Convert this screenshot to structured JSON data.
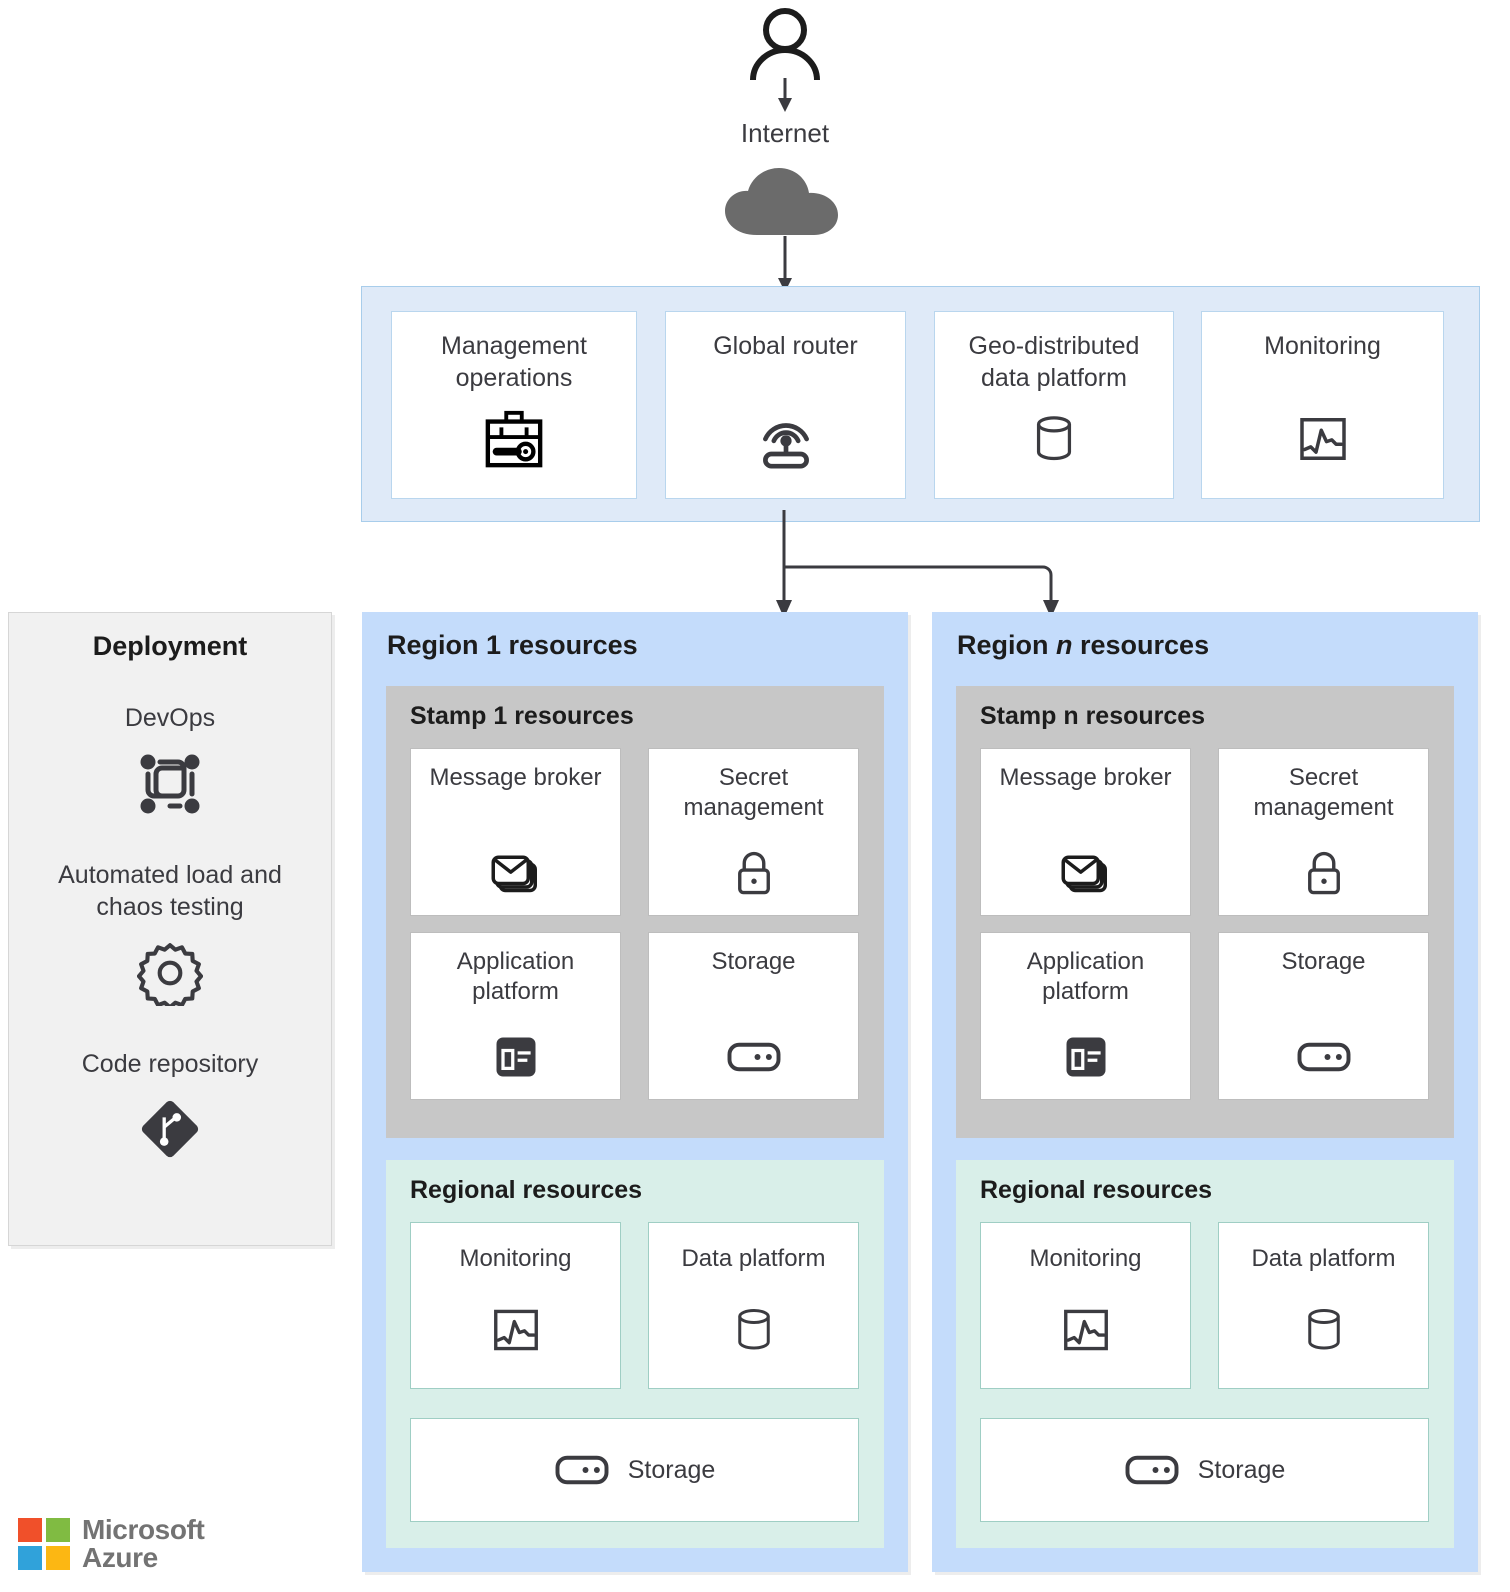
{
  "top": {
    "user_icon": "user-icon",
    "internet_label": "Internet",
    "cloud_icon": "cloud-icon"
  },
  "global_band": {
    "cards": [
      {
        "label": "Management operations",
        "icon": "toolbox-wrench-icon"
      },
      {
        "label": "Global router",
        "icon": "router-antenna-icon"
      },
      {
        "label": "Geo-distributed data platform",
        "icon": "database-cylinder-icon"
      },
      {
        "label": "Monitoring",
        "icon": "chart-monitor-icon"
      }
    ]
  },
  "deployment": {
    "title": "Deployment",
    "items": [
      {
        "label": "DevOps",
        "icon": "devops-loop-icon"
      },
      {
        "label": "Automated load and chaos testing",
        "icon": "gear-icon"
      },
      {
        "label": "Code repository",
        "icon": "git-repository-icon"
      }
    ]
  },
  "regions": [
    {
      "title_prefix": "Region ",
      "title_var": "1",
      "title_suffix": " resources",
      "var_italic": false,
      "stamp": {
        "title": "Stamp 1 resources",
        "cards": [
          {
            "label": "Message broker",
            "icon": "stacked-envelopes-icon"
          },
          {
            "label": "Secret management",
            "icon": "padlock-icon"
          },
          {
            "label": "Application platform",
            "icon": "app-window-icon"
          },
          {
            "label": "Storage",
            "icon": "disk-icon"
          }
        ]
      },
      "regional": {
        "title": "Regional resources",
        "cards": [
          {
            "label": "Monitoring",
            "icon": "chart-monitor-icon"
          },
          {
            "label": "Data platform",
            "icon": "database-cylinder-icon"
          }
        ],
        "wide_card": {
          "label": "Storage",
          "icon": "disk-icon"
        }
      }
    },
    {
      "title_prefix": "Region ",
      "title_var": "n",
      "title_suffix": " resources",
      "var_italic": true,
      "stamp": {
        "title": "Stamp n resources",
        "cards": [
          {
            "label": "Message broker",
            "icon": "stacked-envelopes-icon"
          },
          {
            "label": "Secret management",
            "icon": "padlock-icon"
          },
          {
            "label": "Application platform",
            "icon": "app-window-icon"
          },
          {
            "label": "Storage",
            "icon": "disk-icon"
          }
        ]
      },
      "regional": {
        "title": "Regional resources",
        "cards": [
          {
            "label": "Monitoring",
            "icon": "chart-monitor-icon"
          },
          {
            "label": "Data platform",
            "icon": "database-cylinder-icon"
          }
        ],
        "wide_card": {
          "label": "Storage",
          "icon": "disk-icon"
        }
      }
    }
  ],
  "logo": {
    "line1": "Microsoft",
    "line2": "Azure",
    "square_colors": [
      "#f0502a",
      "#80bb42",
      "#30a2da",
      "#fcb713"
    ],
    "text_color": "#737373"
  },
  "colors": {
    "global_band_bg": "#dfeaf8",
    "global_band_border": "#a8cdeb",
    "region_bg": "#c4dcfb",
    "stamp_bg": "#c7c7c7",
    "regional_bg": "#d9efe9",
    "deployment_bg": "#f1f1f1",
    "cloud": "#6b6b6b",
    "ink": "#3b3b40"
  }
}
